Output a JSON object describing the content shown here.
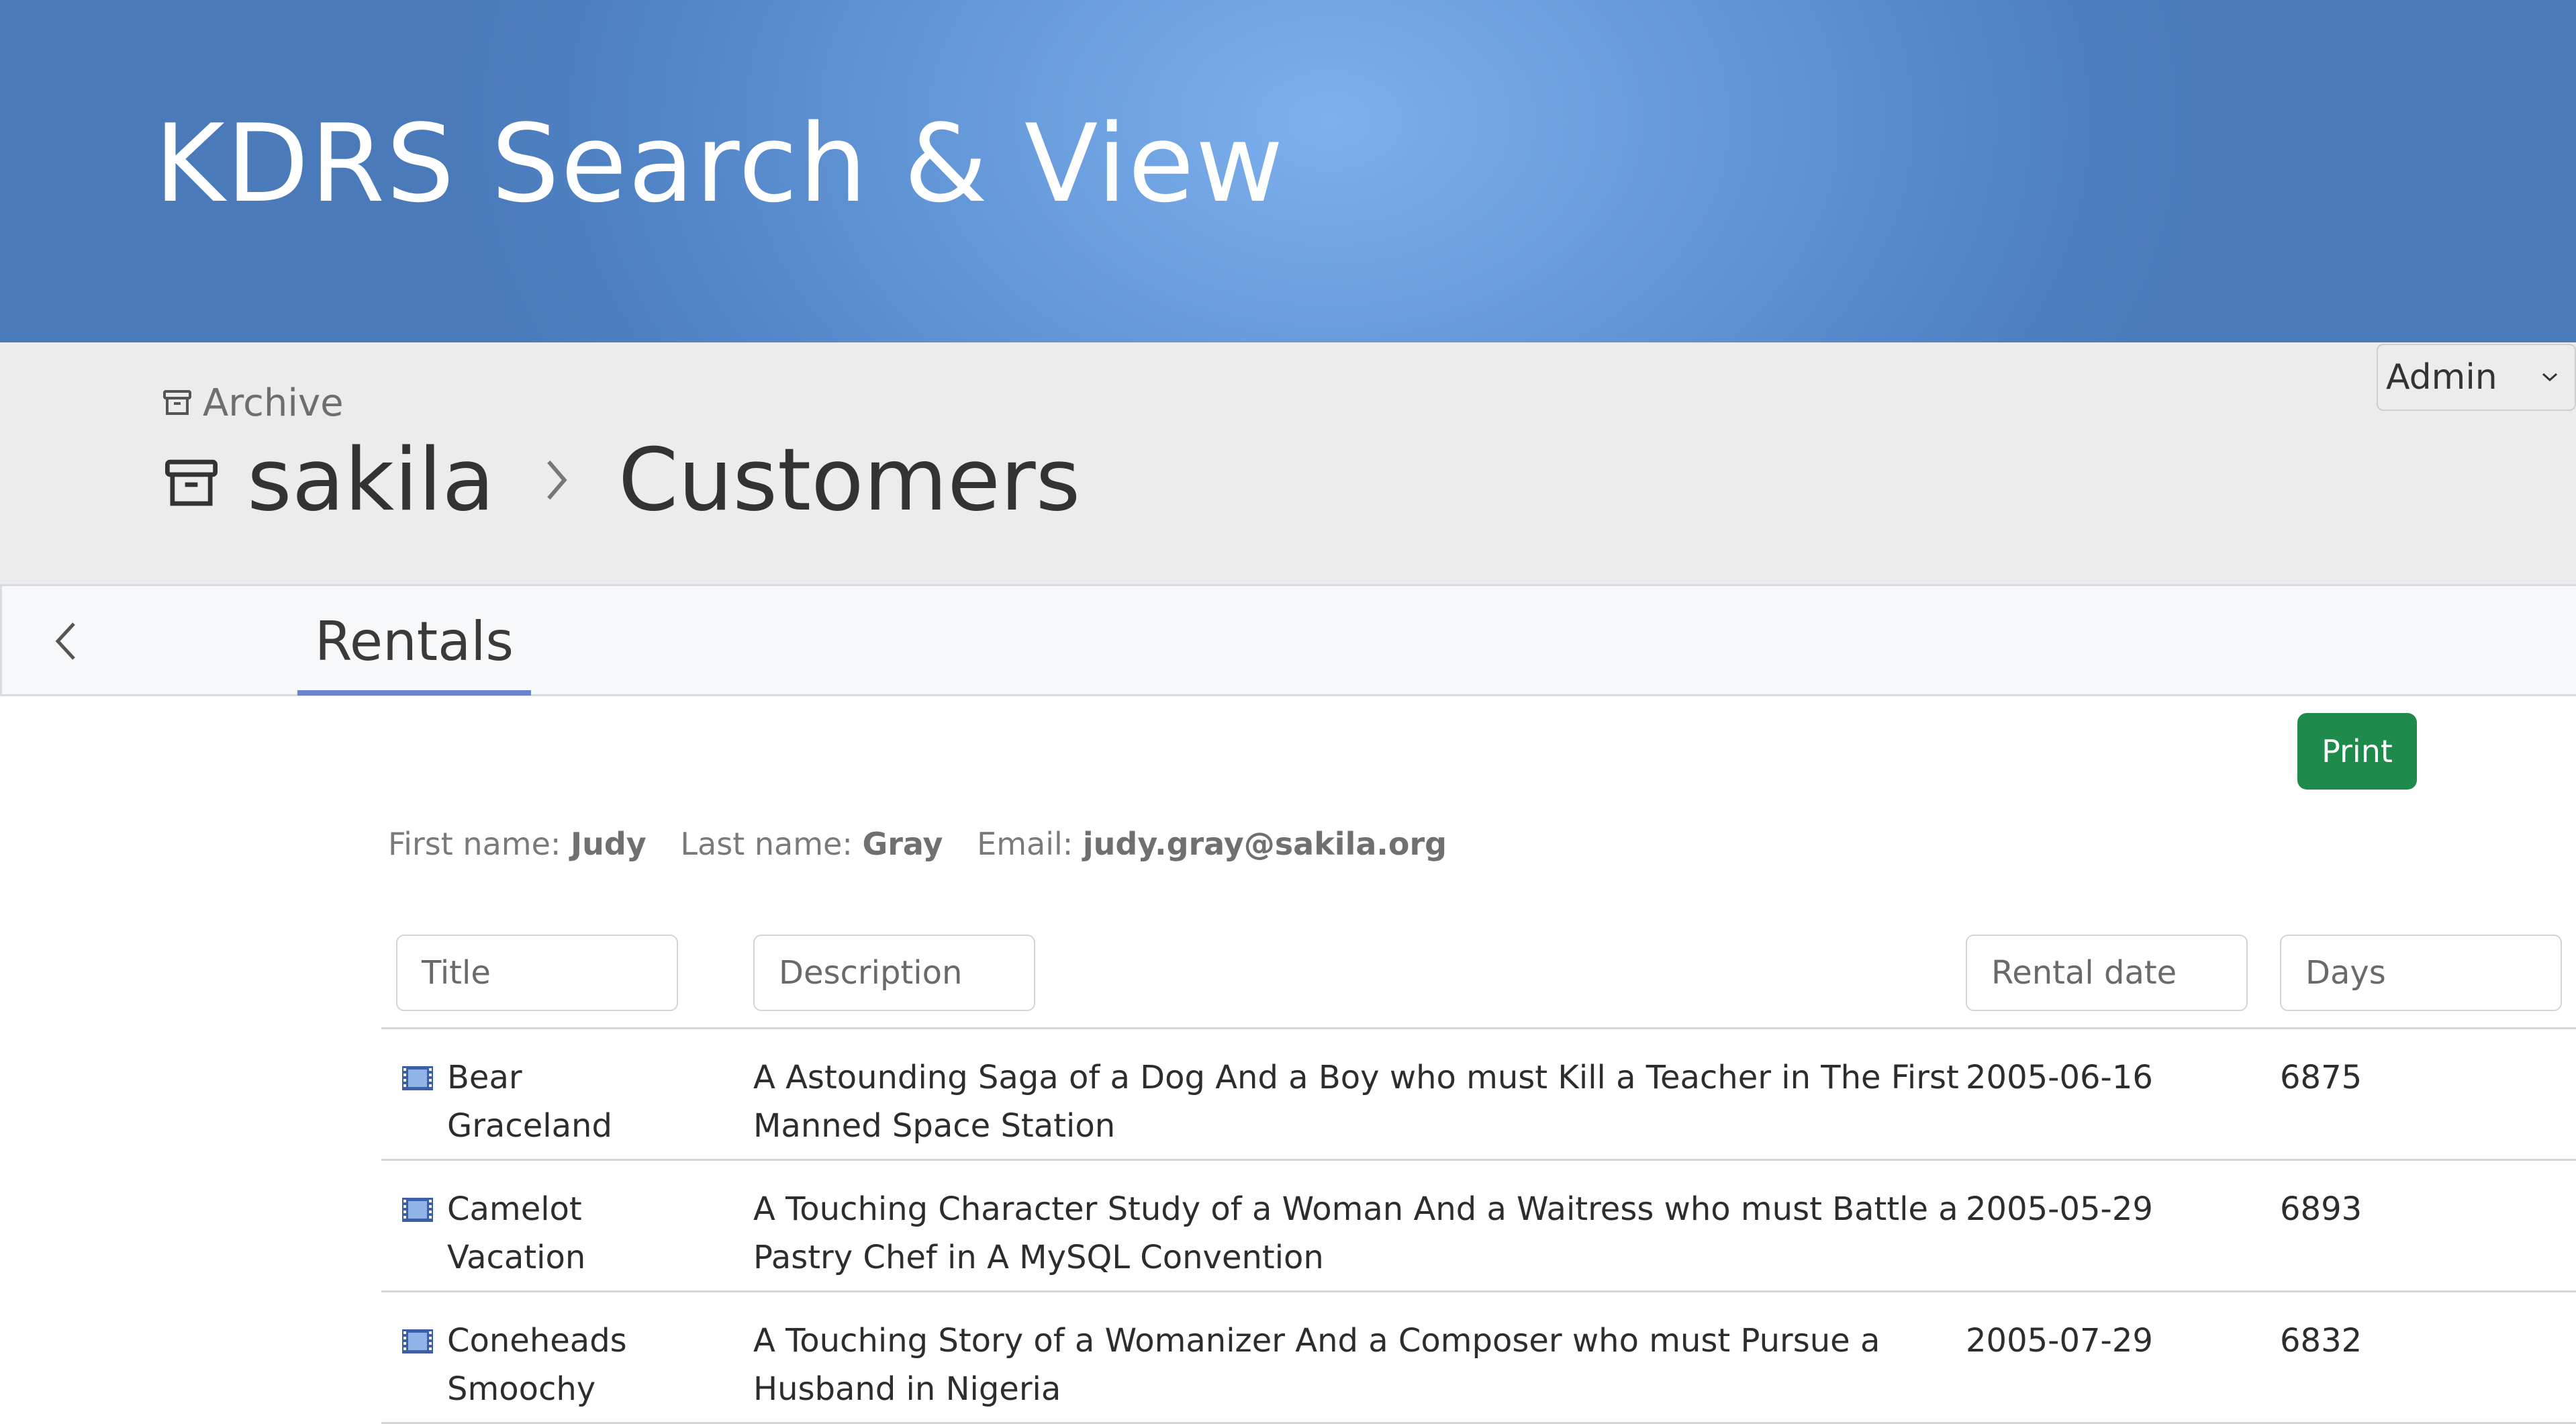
{
  "app": {
    "title": "KDRS Search & View"
  },
  "breadcrumb": {
    "archive_label": "Archive",
    "database": "sakila",
    "table": "Customers"
  },
  "user_menu": {
    "selected": "Admin"
  },
  "tabs": [
    {
      "label": "Rentals",
      "active": true
    }
  ],
  "toolbar": {
    "print_label": "Print"
  },
  "customer": {
    "first_name_label": "First name:",
    "first_name": "Judy",
    "last_name_label": "Last name:",
    "last_name": "Gray",
    "email_label": "Email:",
    "email": "judy.gray@sakila.org"
  },
  "table": {
    "columns": [
      {
        "placeholder": "Title"
      },
      {
        "placeholder": "Description"
      },
      {
        "placeholder": "Rental date"
      },
      {
        "placeholder": "Days"
      }
    ],
    "rows": [
      {
        "title": "Bear Graceland",
        "description": "A Astounding Saga of a Dog And a Boy who must Kill a Teacher in The First Manned Space Station",
        "rental_date": "2005-06-16",
        "days": "6875"
      },
      {
        "title": "Camelot Vacation",
        "description": "A Touching Character Study of a Woman And a Waitress who must Battle a Pastry Chef in A MySQL Convention",
        "rental_date": "2005-05-29",
        "days": "6893"
      },
      {
        "title": "Coneheads Smoochy",
        "description": "A Touching Story of a Womanizer And a Composer who must Pursue a Husband in Nigeria",
        "rental_date": "2005-07-29",
        "days": "6832"
      }
    ]
  },
  "colors": {
    "banner": "#5286c8",
    "banner_highlight": "#7eb0ee",
    "crumb_background": "#ececec",
    "tab_underline": "#6b84cf",
    "print_button": "#1e8a4c"
  },
  "icons": {
    "archive": "archive-box-icon",
    "back": "chevron-left-icon",
    "breadcrumb_separator": "chevron-right-icon",
    "select": "chevron-down-icon",
    "film": "film-icon"
  }
}
